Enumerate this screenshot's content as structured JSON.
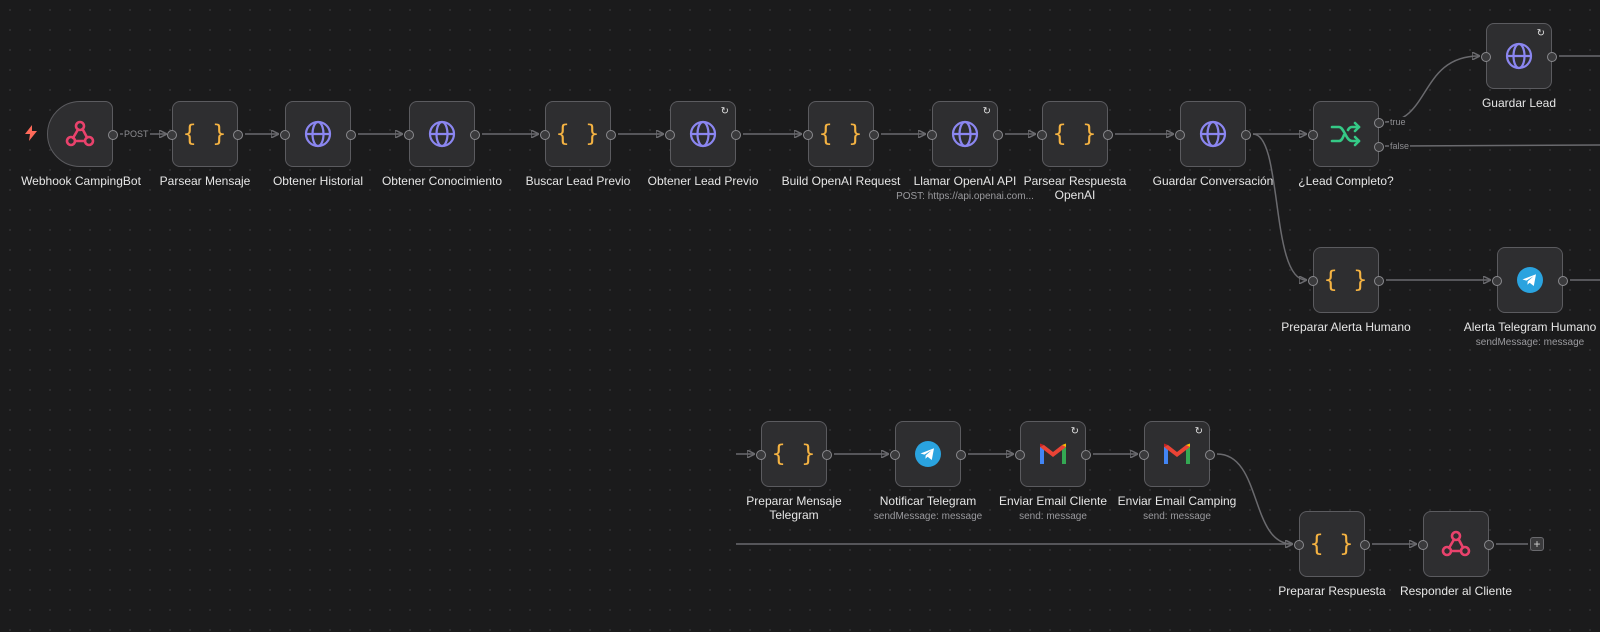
{
  "nodes": {
    "webhook": {
      "label": "Webhook CampingBot",
      "connector": "POST"
    },
    "parsear_mensaje": {
      "label": "Parsear Mensaje"
    },
    "obtener_historial": {
      "label": "Obtener Historial"
    },
    "obtener_conocimiento": {
      "label": "Obtener Conocimiento"
    },
    "buscar_lead": {
      "label": "Buscar Lead Previo"
    },
    "obtener_lead": {
      "label": "Obtener Lead Previo"
    },
    "build_openai": {
      "label": "Build OpenAI Request"
    },
    "llamar_openai": {
      "label": "Llamar OpenAI API",
      "sub": "POST: https://api.openai.com..."
    },
    "parsear_respuesta": {
      "label": "Parsear Respuesta OpenAI"
    },
    "guardar_conversacion": {
      "label": "Guardar Conversación"
    },
    "lead_completo": {
      "label": "¿Lead Completo?",
      "true_label": "true",
      "false_label": "false"
    },
    "guardar_lead": {
      "label": "Guardar Lead"
    },
    "preparar_alerta": {
      "label": "Preparar Alerta Humano"
    },
    "alerta_telegram": {
      "label": "Alerta Telegram Humano",
      "sub": "sendMessage: message"
    },
    "preparar_mensaje": {
      "label": "Preparar Mensaje Telegram"
    },
    "notificar_telegram": {
      "label": "Notificar Telegram",
      "sub": "sendMessage: message"
    },
    "email_cliente": {
      "label": "Enviar Email Cliente",
      "sub": "send: message"
    },
    "email_camping": {
      "label": "Enviar Email Camping",
      "sub": "send: message"
    },
    "preparar_respuesta": {
      "label": "Preparar Respuesta"
    },
    "responder_cliente": {
      "label": "Responder al Cliente"
    }
  },
  "icons": {
    "loop": "↻",
    "braces": "{ }",
    "add": "+"
  },
  "colors": {
    "webhook": "#e9426c",
    "http": "#8b86f0",
    "code": "#f5b342",
    "if": "#35c986",
    "telegram": "#2aa3df",
    "trigger_bolt": "#ff6a5a"
  }
}
